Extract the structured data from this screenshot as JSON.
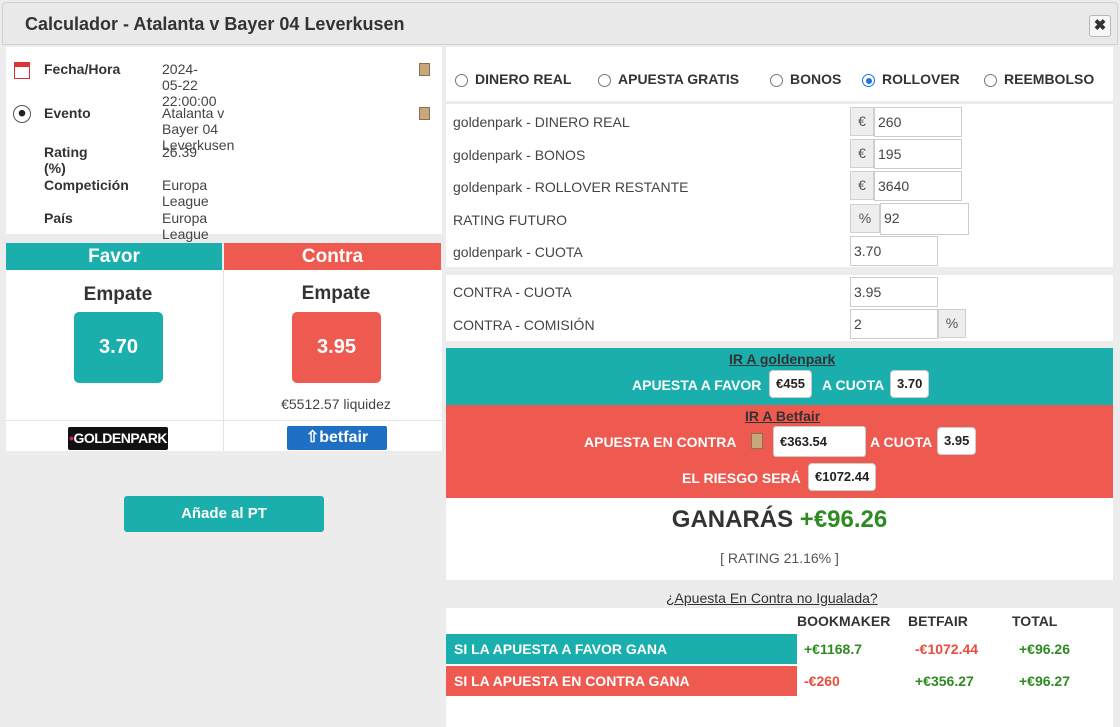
{
  "window": {
    "title": "Calculador - Atalanta v Bayer 04 Leverkusen",
    "close_glyph": "✖"
  },
  "info": {
    "rows": [
      {
        "label": "Fecha/Hora",
        "value": "2024-05-22 22:00:00",
        "icon": "calendar-icon"
      },
      {
        "label": "Evento",
        "value": "Atalanta v Bayer 04 Leverkusen",
        "icon": "soccer-ball-icon"
      },
      {
        "label": "Rating (%)",
        "value": "26.39"
      },
      {
        "label": "Competición",
        "value": "Europa League"
      },
      {
        "label": "País",
        "value": "Europa League"
      }
    ]
  },
  "favor": {
    "header": "Favor",
    "selection": "Empate",
    "odds": "3.70",
    "bookmaker_logo": "GOLDENPARK",
    "color": "#1aafac"
  },
  "contra": {
    "header": "Contra",
    "selection": "Empate",
    "odds": "3.95",
    "liquidity": "€5512.57 liquidez",
    "exchange_logo": "betfair",
    "color": "#ef5a50"
  },
  "add_button": "Añade al PT",
  "bet_types": [
    {
      "label": "DINERO REAL",
      "selected": false
    },
    {
      "label": "APUESTA GRATIS",
      "selected": false
    },
    {
      "label": "BONOS",
      "selected": false
    },
    {
      "label": "ROLLOVER",
      "selected": true
    },
    {
      "label": "REEMBOLSO",
      "selected": false
    }
  ],
  "fields": {
    "real_money": {
      "label": "goldenpark - DINERO REAL",
      "addon": "€",
      "value": "260"
    },
    "bonus": {
      "label": "goldenpark - BONOS",
      "addon": "€",
      "value": "195"
    },
    "rollover": {
      "label": "goldenpark - ROLLOVER RESTANTE",
      "addon": "€",
      "value": "3640"
    },
    "future_rating": {
      "label": "RATING FUTURO",
      "addon": "%",
      "value": "92"
    },
    "bookie_odds": {
      "label": "goldenpark - CUOTA",
      "value": "3.70"
    },
    "lay_odds": {
      "label": "CONTRA - CUOTA",
      "value": "3.95"
    },
    "commission": {
      "label": "CONTRA - COMISIÓN",
      "value": "2",
      "addon": "%"
    }
  },
  "back_instruction": {
    "link": "IR A goldenpark",
    "text1": "APUESTA A FAVOR",
    "stake": "€455",
    "text2": "A CUOTA",
    "odds": "3.70"
  },
  "lay_instruction": {
    "link": "IR A Betfair",
    "text1": "APUESTA EN CONTRA",
    "stake": "€363.54",
    "text2": "A CUOTA",
    "odds": "3.95",
    "risk_label": "EL RIESGO SERÁ",
    "risk": "€1072.44"
  },
  "result": {
    "label": "GANARÁS",
    "amount": "+€96.26",
    "rating": "[ RATING 21.16% ]"
  },
  "unmatched_link": "¿Apuesta En Contra no Igualada?",
  "outcomes": {
    "headers": [
      "BOOKMAKER",
      "BETFAIR",
      "TOTAL"
    ],
    "rows": [
      {
        "label": "SI LA APUESTA A FAVOR GANA",
        "bookmaker": "+€1168.7",
        "betfair": "-€1072.44",
        "total": "+€96.26"
      },
      {
        "label": "SI LA APUESTA EN CONTRA GANA",
        "bookmaker": "-€260",
        "betfair": "+€356.27",
        "total": "+€96.27"
      }
    ]
  }
}
